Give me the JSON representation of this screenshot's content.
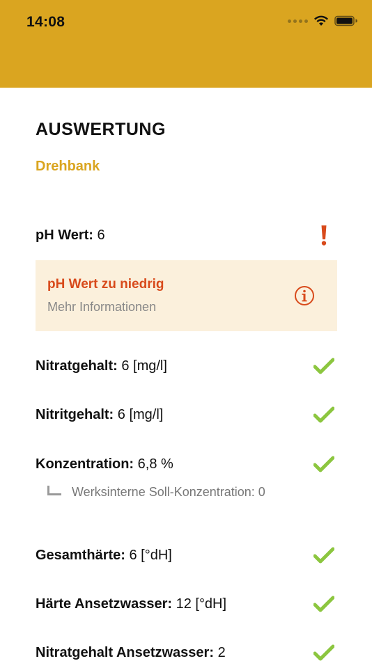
{
  "status_bar": {
    "time": "14:08"
  },
  "colors": {
    "header": "#DAA520",
    "accent": "#DAA520",
    "warning": "#D84A1B",
    "ok": "#8CC63F",
    "warn_bg": "#FBF0DC"
  },
  "page": {
    "title": "AUSWERTUNG",
    "subtitle": "Drehbank"
  },
  "rows": [
    {
      "label": "pH Wert:",
      "value": "6",
      "status": "warning"
    },
    {
      "label": "Nitratgehalt:",
      "value": "6 [mg/l]",
      "status": "ok"
    },
    {
      "label": "Nitritgehalt:",
      "value": "6 [mg/l]",
      "status": "ok"
    },
    {
      "label": "Konzentration:",
      "value": "6,8 %",
      "status": "ok"
    },
    {
      "label": "Gesamthärte:",
      "value": "6 [°dH]",
      "status": "ok"
    },
    {
      "label": "Härte Ansetzwasser:",
      "value": "12 [°dH]",
      "status": "ok"
    },
    {
      "label": "Nitratgehalt Ansetzwasser:",
      "value": "2",
      "status": "ok"
    }
  ],
  "warning_box": {
    "title": "pH Wert zu niedrig",
    "more": "Mehr Informationen"
  },
  "sub_note": {
    "text": "Werksinterne Soll-Konzentration: 0"
  },
  "icons": {
    "warning": "exclamation-icon",
    "ok": "checkmark-icon",
    "info": "info-circle-icon"
  }
}
